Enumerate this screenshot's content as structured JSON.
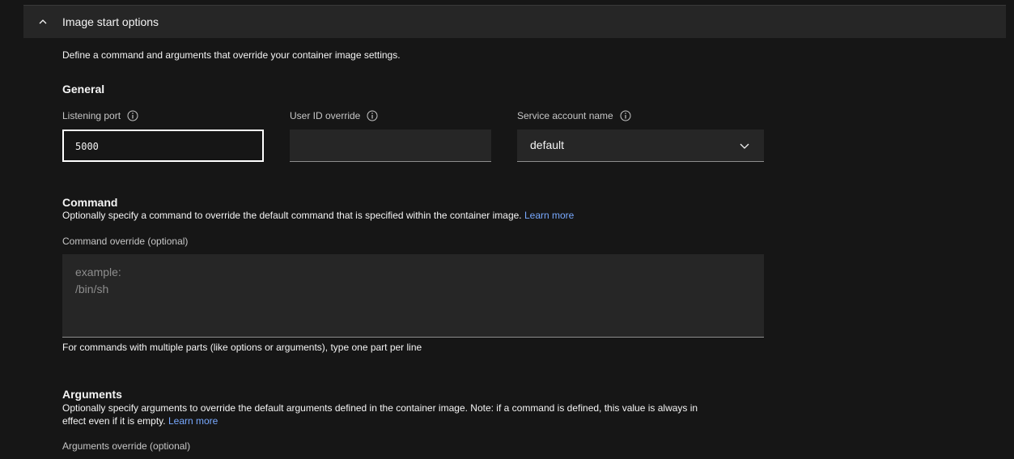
{
  "accordion": {
    "title": "Image start options"
  },
  "intro": "Define a command and arguments that override your container image settings.",
  "general": {
    "heading": "General",
    "listening_port": {
      "label": "Listening port",
      "value": "5000"
    },
    "user_id": {
      "label": "User ID override",
      "value": ""
    },
    "service_account": {
      "label": "Service account name",
      "value": "default"
    }
  },
  "command": {
    "heading": "Command",
    "description": "Optionally specify a command to override the default command that is specified within the container image.",
    "learn_more": "Learn more",
    "field_label": "Command override (optional)",
    "placeholder": "example:\n/bin/sh",
    "helper": "For commands with multiple parts (like options or arguments), type one part per line"
  },
  "arguments": {
    "heading": "Arguments",
    "description_line1": "Optionally specify arguments to override the default arguments defined in the container image. Note: if a command is defined, this value is always in",
    "description_line2": "effect even if it is empty.",
    "learn_more": "Learn more",
    "field_label": "Arguments override (optional)"
  },
  "icons": {
    "collapse": "chevron-up-icon",
    "info": "information-icon",
    "dropdown": "chevron-down-icon"
  },
  "colors": {
    "link": "#78a9ff",
    "background": "#161616",
    "field": "#262626"
  }
}
